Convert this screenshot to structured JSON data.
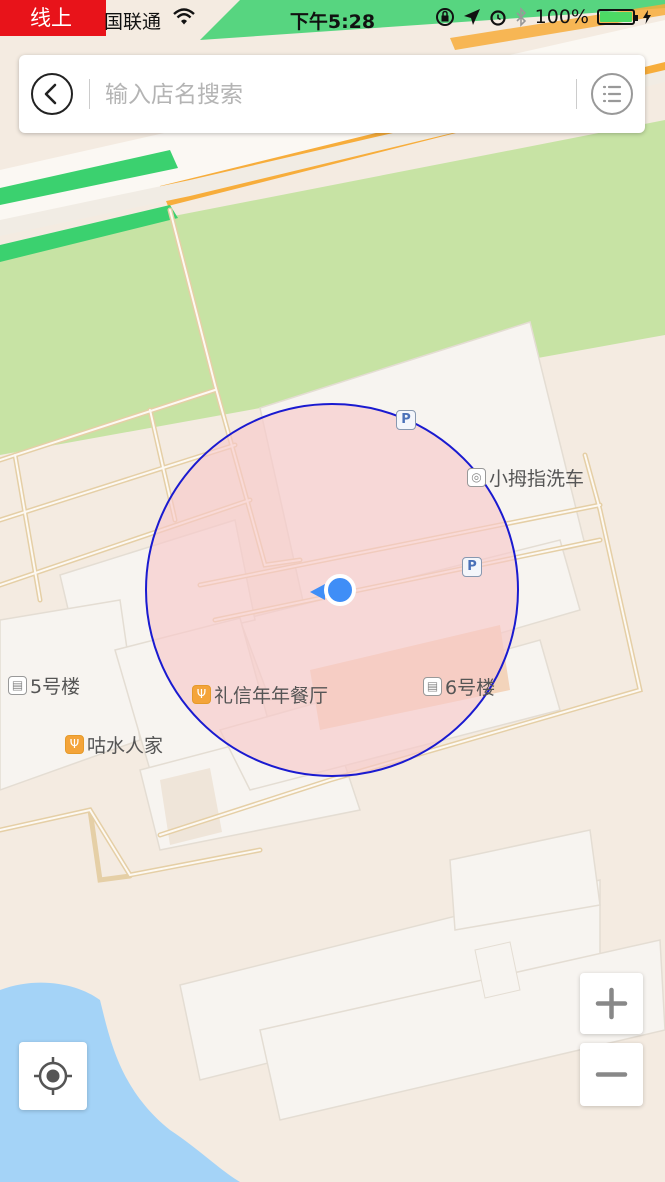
{
  "status_bar": {
    "mode_tag": "线上",
    "carrier": "国联通",
    "time": "下午5:28",
    "battery_text": "100%",
    "battery_level": 1.0
  },
  "search": {
    "placeholder": "输入店名搜索",
    "back_icon": "chevron-left-icon",
    "menu_icon": "list-icon"
  },
  "map": {
    "labels": {
      "car_wash": "小拇指洗车",
      "building_5": "5号楼",
      "building_6": "6号楼",
      "restaurant_lixin": "礼信年年餐厅",
      "restaurant_gushui": "咕水人家"
    },
    "parking_icon_text": "P",
    "colors": {
      "land": "#f4ebe1",
      "park": "#c7e3a4",
      "water": "#a4d3f7",
      "radius_fill": "#f8caca",
      "radius_stroke": "#1a1ad0",
      "user_dot": "#3f8ef7",
      "traffic_green": "#3bd16f",
      "traffic_orange": "#f7ad3b"
    }
  },
  "controls": {
    "zoom_in_icon": "plus-icon",
    "zoom_out_icon": "minus-icon",
    "locate_icon": "crosshair-icon"
  }
}
